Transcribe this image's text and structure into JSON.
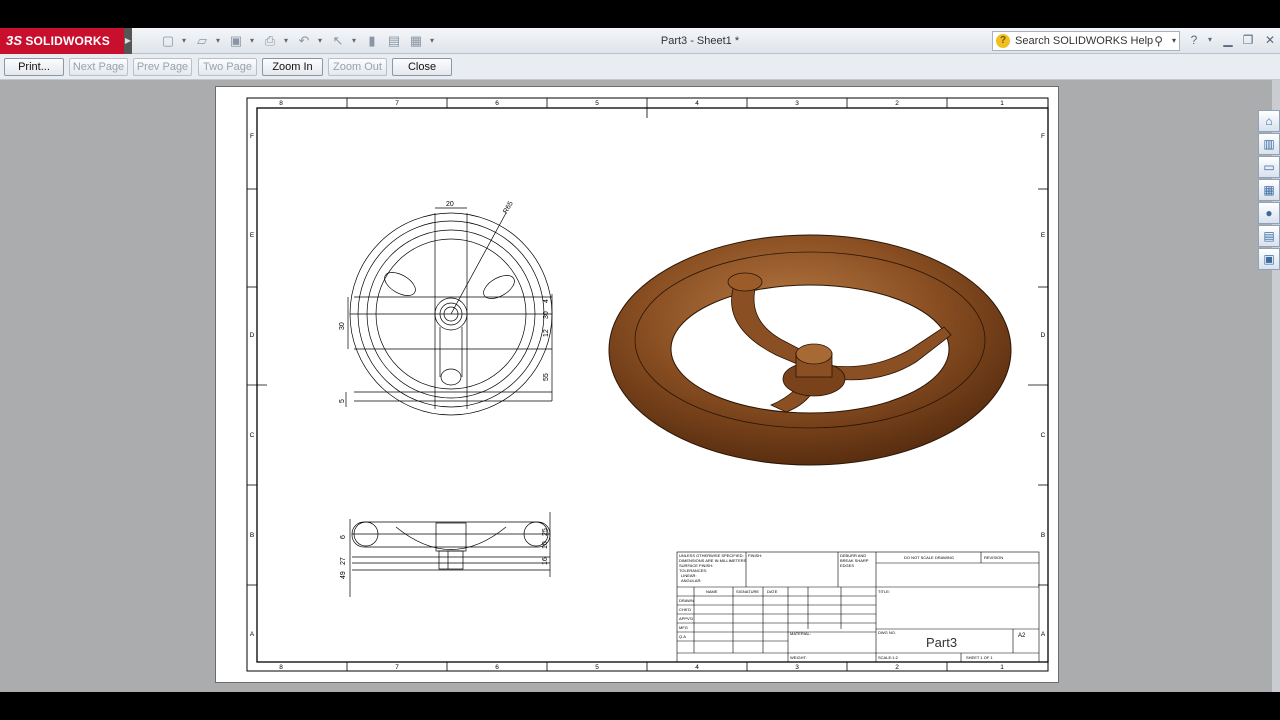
{
  "app": {
    "brand": "SOLIDWORKS",
    "brand_prefix": "3S",
    "window_title": "Part3 - Sheet1 *",
    "help_search_placeholder": "Search SOLIDWORKS Help"
  },
  "toolbar_icons": [
    "new-icon",
    "open-icon",
    "save-icon",
    "print-icon",
    "undo-icon",
    "select-icon",
    "rebuild-icon",
    "file-properties-icon",
    "options-icon"
  ],
  "print_preview": {
    "buttons": [
      {
        "label": "Print...",
        "enabled": true
      },
      {
        "label": "Next Page",
        "enabled": false
      },
      {
        "label": "Prev Page",
        "enabled": false
      },
      {
        "label": "Two Page",
        "enabled": false
      },
      {
        "label": "Zoom In",
        "enabled": true
      },
      {
        "label": "Zoom Out",
        "enabled": false
      },
      {
        "label": "Close",
        "enabled": true
      }
    ]
  },
  "sheet": {
    "zone_columns": [
      "8",
      "7",
      "6",
      "5",
      "4",
      "3",
      "2",
      "1"
    ],
    "zone_rows": [
      "F",
      "E",
      "D",
      "C",
      "B",
      "A"
    ],
    "front_view_dims": {
      "top_width": "20",
      "radius": "R65",
      "left_height": "30",
      "bottom_offset": "5",
      "right_1": "4",
      "right_2": "30",
      "right_3": "12",
      "right_4": "55"
    },
    "side_view_dims": {
      "left_1": "6",
      "left_2": "27",
      "left_3": "49",
      "right_1": "25",
      "right_2": "10",
      "right_3": "16"
    },
    "title_block": {
      "part_name": "Part3",
      "sheet_size": "A2",
      "do_not_scale": "DO NOT SCALE DRAWING",
      "revision": "REVISION",
      "title_label": "TITLE:",
      "dwg_no_label": "DWG NO.",
      "col_name": "NAME",
      "col_signature": "SIGNATURE",
      "col_date": "DATE",
      "rows": [
        "DRAWN",
        "CHK'D",
        "APPV'D",
        "MFG",
        "Q.A"
      ],
      "material_label": "MATERIAL:",
      "weight_label": "WEIGHT:",
      "scale_label": "SCALE:1:2",
      "sheet_label": "SHEET 1 OF 1",
      "finish_label": "FINISH:",
      "notes": [
        "UNLESS OTHERWISE SPECIFIED:",
        "DIMENSIONS ARE IN MILLIMETERS",
        "SURFACE FINISH:",
        "TOLERANCES:",
        "LINEAR:",
        "ANGULAR:"
      ],
      "deburr": [
        "DEBURR AND",
        "BREAK SHARP",
        "EDGES"
      ]
    }
  },
  "task_pane_icons": [
    "home-icon",
    "design-library-icon",
    "file-explorer-icon",
    "view-palette-icon",
    "appearances-icon",
    "custom-properties-icon",
    "forum-icon"
  ],
  "colors": {
    "wheel_brown": "#8a4f22",
    "brand_red": "#c8102e"
  }
}
